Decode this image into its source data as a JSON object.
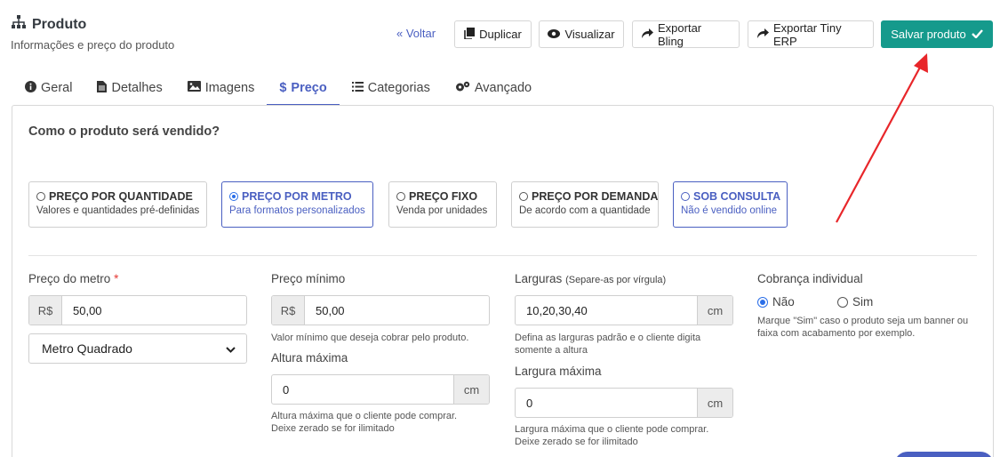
{
  "header": {
    "title": "Produto",
    "subtitle": "Informações e preço do produto",
    "icon": "sitemap-icon"
  },
  "toolbar": {
    "back_label": "« Voltar",
    "duplicate_label": "Duplicar",
    "view_label": "Visualizar",
    "export_bling_label": "Exportar Bling",
    "export_tiny_label": "Exportar Tiny ERP",
    "save_label": "Salvar produto"
  },
  "tabs": [
    {
      "label": "Geral",
      "icon": "info-circle-icon"
    },
    {
      "label": "Detalhes",
      "icon": "file-icon"
    },
    {
      "label": "Imagens",
      "icon": "image-icon"
    },
    {
      "label": "Preço",
      "icon": "dollar-icon",
      "active": true
    },
    {
      "label": "Categorias",
      "icon": "list-icon"
    },
    {
      "label": "Avançado",
      "icon": "gears-icon"
    }
  ],
  "section_title": "Como o produto será vendido?",
  "sale_options": [
    {
      "title": "PREÇO POR QUANTIDADE",
      "desc": "Valores e quantidades pré-definidas",
      "selected": false
    },
    {
      "title": "PREÇO POR METRO",
      "desc": "Para formatos personalizados",
      "selected": true
    },
    {
      "title": "PREÇO FIXO",
      "desc": "Venda por unidades",
      "selected": false
    },
    {
      "title": "PREÇO POR DEMANDA",
      "desc": "De acordo com a quantidade",
      "selected": false
    },
    {
      "title": "SOB CONSULTA",
      "desc": "Não é vendido online",
      "selected": false
    }
  ],
  "form": {
    "preco_metro": {
      "label": "Preço do metro",
      "required_mark": "*",
      "prefix": "R$",
      "value": "50,00"
    },
    "unit_select": {
      "value": "Metro Quadrado"
    },
    "preco_minimo": {
      "label": "Preço mínimo",
      "prefix": "R$",
      "value": "50,00",
      "help": "Valor mínimo que deseja cobrar pelo produto."
    },
    "altura_maxima": {
      "label": "Altura máxima",
      "value": "0",
      "suffix": "cm",
      "help_1": "Altura máxima que o cliente pode comprar.",
      "help_2": "Deixe zerado se for ilimitado"
    },
    "larguras": {
      "label": "Larguras",
      "label_note": "(Separe-as por vírgula)",
      "value": "10,20,30,40",
      "suffix": "cm",
      "help_1": "Defina as larguras padrão e o cliente digita",
      "help_2": "somente a altura"
    },
    "largura_maxima": {
      "label": "Largura máxima",
      "value": "0",
      "suffix": "cm",
      "help_1": "Largura máxima que o cliente pode comprar.",
      "help_2": "Deixe zerado se for ilimitado"
    },
    "cobranca": {
      "label": "Cobrança individual",
      "option_no": "Não",
      "option_yes": "Sim",
      "selected": "Não",
      "help_1": "Marque \"Sim\" caso o produto seja um banner ou",
      "help_2": "faixa com acabamento por exemplo."
    }
  },
  "colors": {
    "primary": "#4a5fc1",
    "save": "#159a8c",
    "annotation_arrow": "#e8262a"
  }
}
